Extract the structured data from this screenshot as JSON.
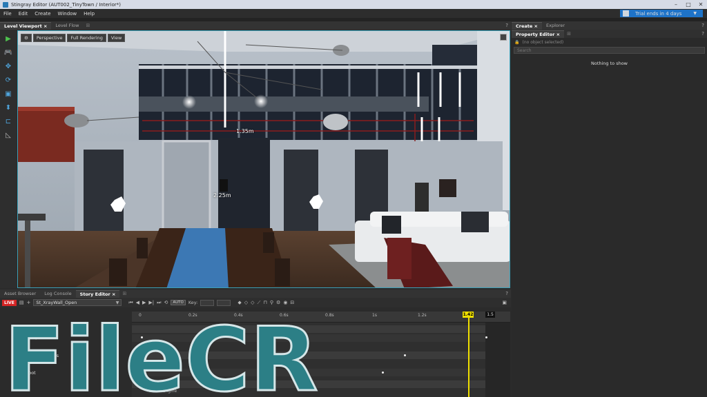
{
  "window": {
    "title": "Stingray Editor (AUT002_TinyTown / Interior*)",
    "trial": "Trial ends in 4 days"
  },
  "menu": [
    "File",
    "Edit",
    "Create",
    "Window",
    "Help"
  ],
  "left_tabs": {
    "active": "Level Viewport",
    "other": "Level Flow"
  },
  "viewport": {
    "buttons": [
      "Perspective",
      "Full Rendering",
      "View"
    ],
    "measure_1": "1.35m",
    "measure_2": "2.25m"
  },
  "right_panel": {
    "tabs": {
      "create": "Create",
      "explorer": "Explorer"
    },
    "property_tab": "Property Editor",
    "no_object": "(no object selected)",
    "search_placeholder": "Search",
    "empty_message": "Nothing to show"
  },
  "bottom_tabs": {
    "asset": "Asset Browser",
    "log": "Log Console",
    "story": "Story Editor"
  },
  "story": {
    "live": "LIVE",
    "story_name": "St_XrayWall_Open",
    "auto": "AUTO",
    "key_label": "Key:",
    "playhead": "1.42",
    "end": "1.5",
    "ticks": [
      "0",
      "0.2s",
      "0.4s",
      "0.6s",
      "0.8s",
      "1s",
      "1.2s"
    ],
    "tracks": [
      "XrayWall",
      "Measurements",
      "Root"
    ],
    "bottom_label": "Editor Engine"
  },
  "watermark": "FileCR"
}
